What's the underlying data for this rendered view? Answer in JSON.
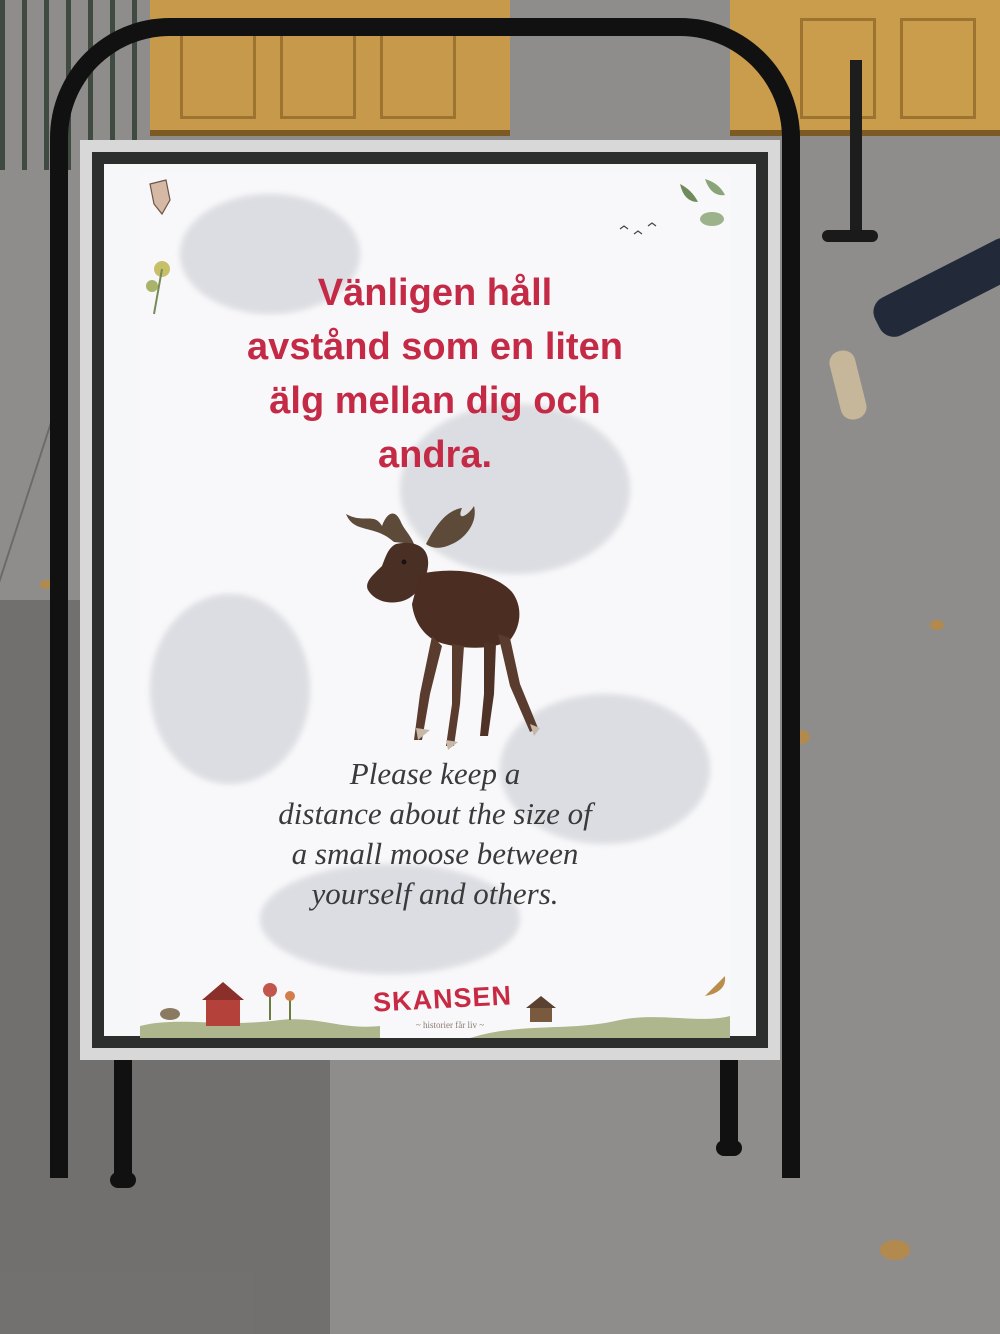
{
  "sign": {
    "swedish_lines": [
      "Vänligen håll",
      "avstånd som en liten",
      "älg mellan dig och",
      "andra."
    ],
    "english_lines": [
      "Please keep a",
      "distance about the size of",
      "a small moose between",
      "yourself and others."
    ],
    "logo": "SKANSEN",
    "tagline": "~ historier får liv ~"
  },
  "colors": {
    "headline": "#c42a45",
    "body_text": "#3a3a3a",
    "logo": "#c72a42",
    "frame": "#111111",
    "pavement": "#8e8d8b"
  },
  "icons": [
    "moose-illustration",
    "hand-icon",
    "flower-icon",
    "birds-icon",
    "leaf-icon",
    "barn-icon",
    "cabin-icon"
  ]
}
